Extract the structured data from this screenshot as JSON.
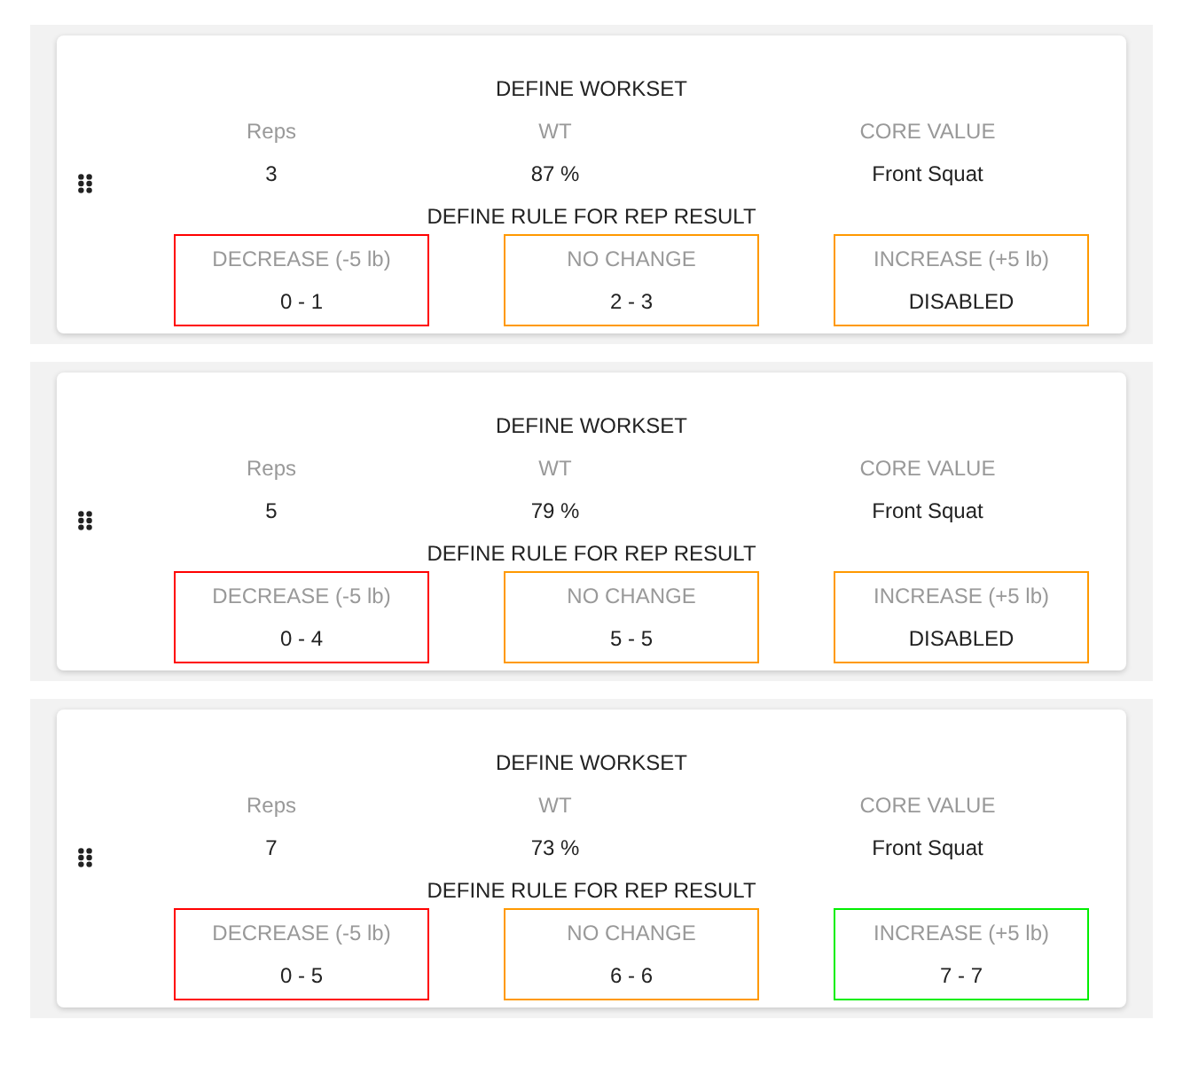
{
  "worksets": [
    {
      "title": "DEFINE WORKSET",
      "fields": [
        {
          "label": "Reps",
          "value": "3"
        },
        {
          "label": "WT",
          "value": "87 %"
        },
        {
          "label": "CORE VALUE",
          "value": "Front Squat"
        }
      ],
      "rule_title": "DEFINE RULE FOR REP RESULT",
      "rules": [
        {
          "label": "DECREASE (-5 lb)",
          "value": "0 - 1",
          "color": "#ff0000"
        },
        {
          "label": "NO CHANGE",
          "value": "2 - 3",
          "color": "#ff9900"
        },
        {
          "label": "INCREASE (+5 lb)",
          "value": "DISABLED",
          "color": "#ff9900"
        }
      ]
    },
    {
      "title": "DEFINE WORKSET",
      "fields": [
        {
          "label": "Reps",
          "value": "5"
        },
        {
          "label": "WT",
          "value": "79 %"
        },
        {
          "label": "CORE VALUE",
          "value": "Front Squat"
        }
      ],
      "rule_title": "DEFINE RULE FOR REP RESULT",
      "rules": [
        {
          "label": "DECREASE (-5 lb)",
          "value": "0 - 4",
          "color": "#ff0000"
        },
        {
          "label": "NO CHANGE",
          "value": "5 - 5",
          "color": "#ff9900"
        },
        {
          "label": "INCREASE (+5 lb)",
          "value": "DISABLED",
          "color": "#ff9900"
        }
      ]
    },
    {
      "title": "DEFINE WORKSET",
      "fields": [
        {
          "label": "Reps",
          "value": "7"
        },
        {
          "label": "WT",
          "value": "73 %"
        },
        {
          "label": "CORE VALUE",
          "value": "Front Squat"
        }
      ],
      "rule_title": "DEFINE RULE FOR REP RESULT",
      "rules": [
        {
          "label": "DECREASE (-5 lb)",
          "value": "0 - 5",
          "color": "#ff0000"
        },
        {
          "label": "NO CHANGE",
          "value": "6 - 6",
          "color": "#ff9900"
        },
        {
          "label": "INCREASE (+5 lb)",
          "value": "7 - 7",
          "color": "#00ee00"
        }
      ]
    }
  ]
}
